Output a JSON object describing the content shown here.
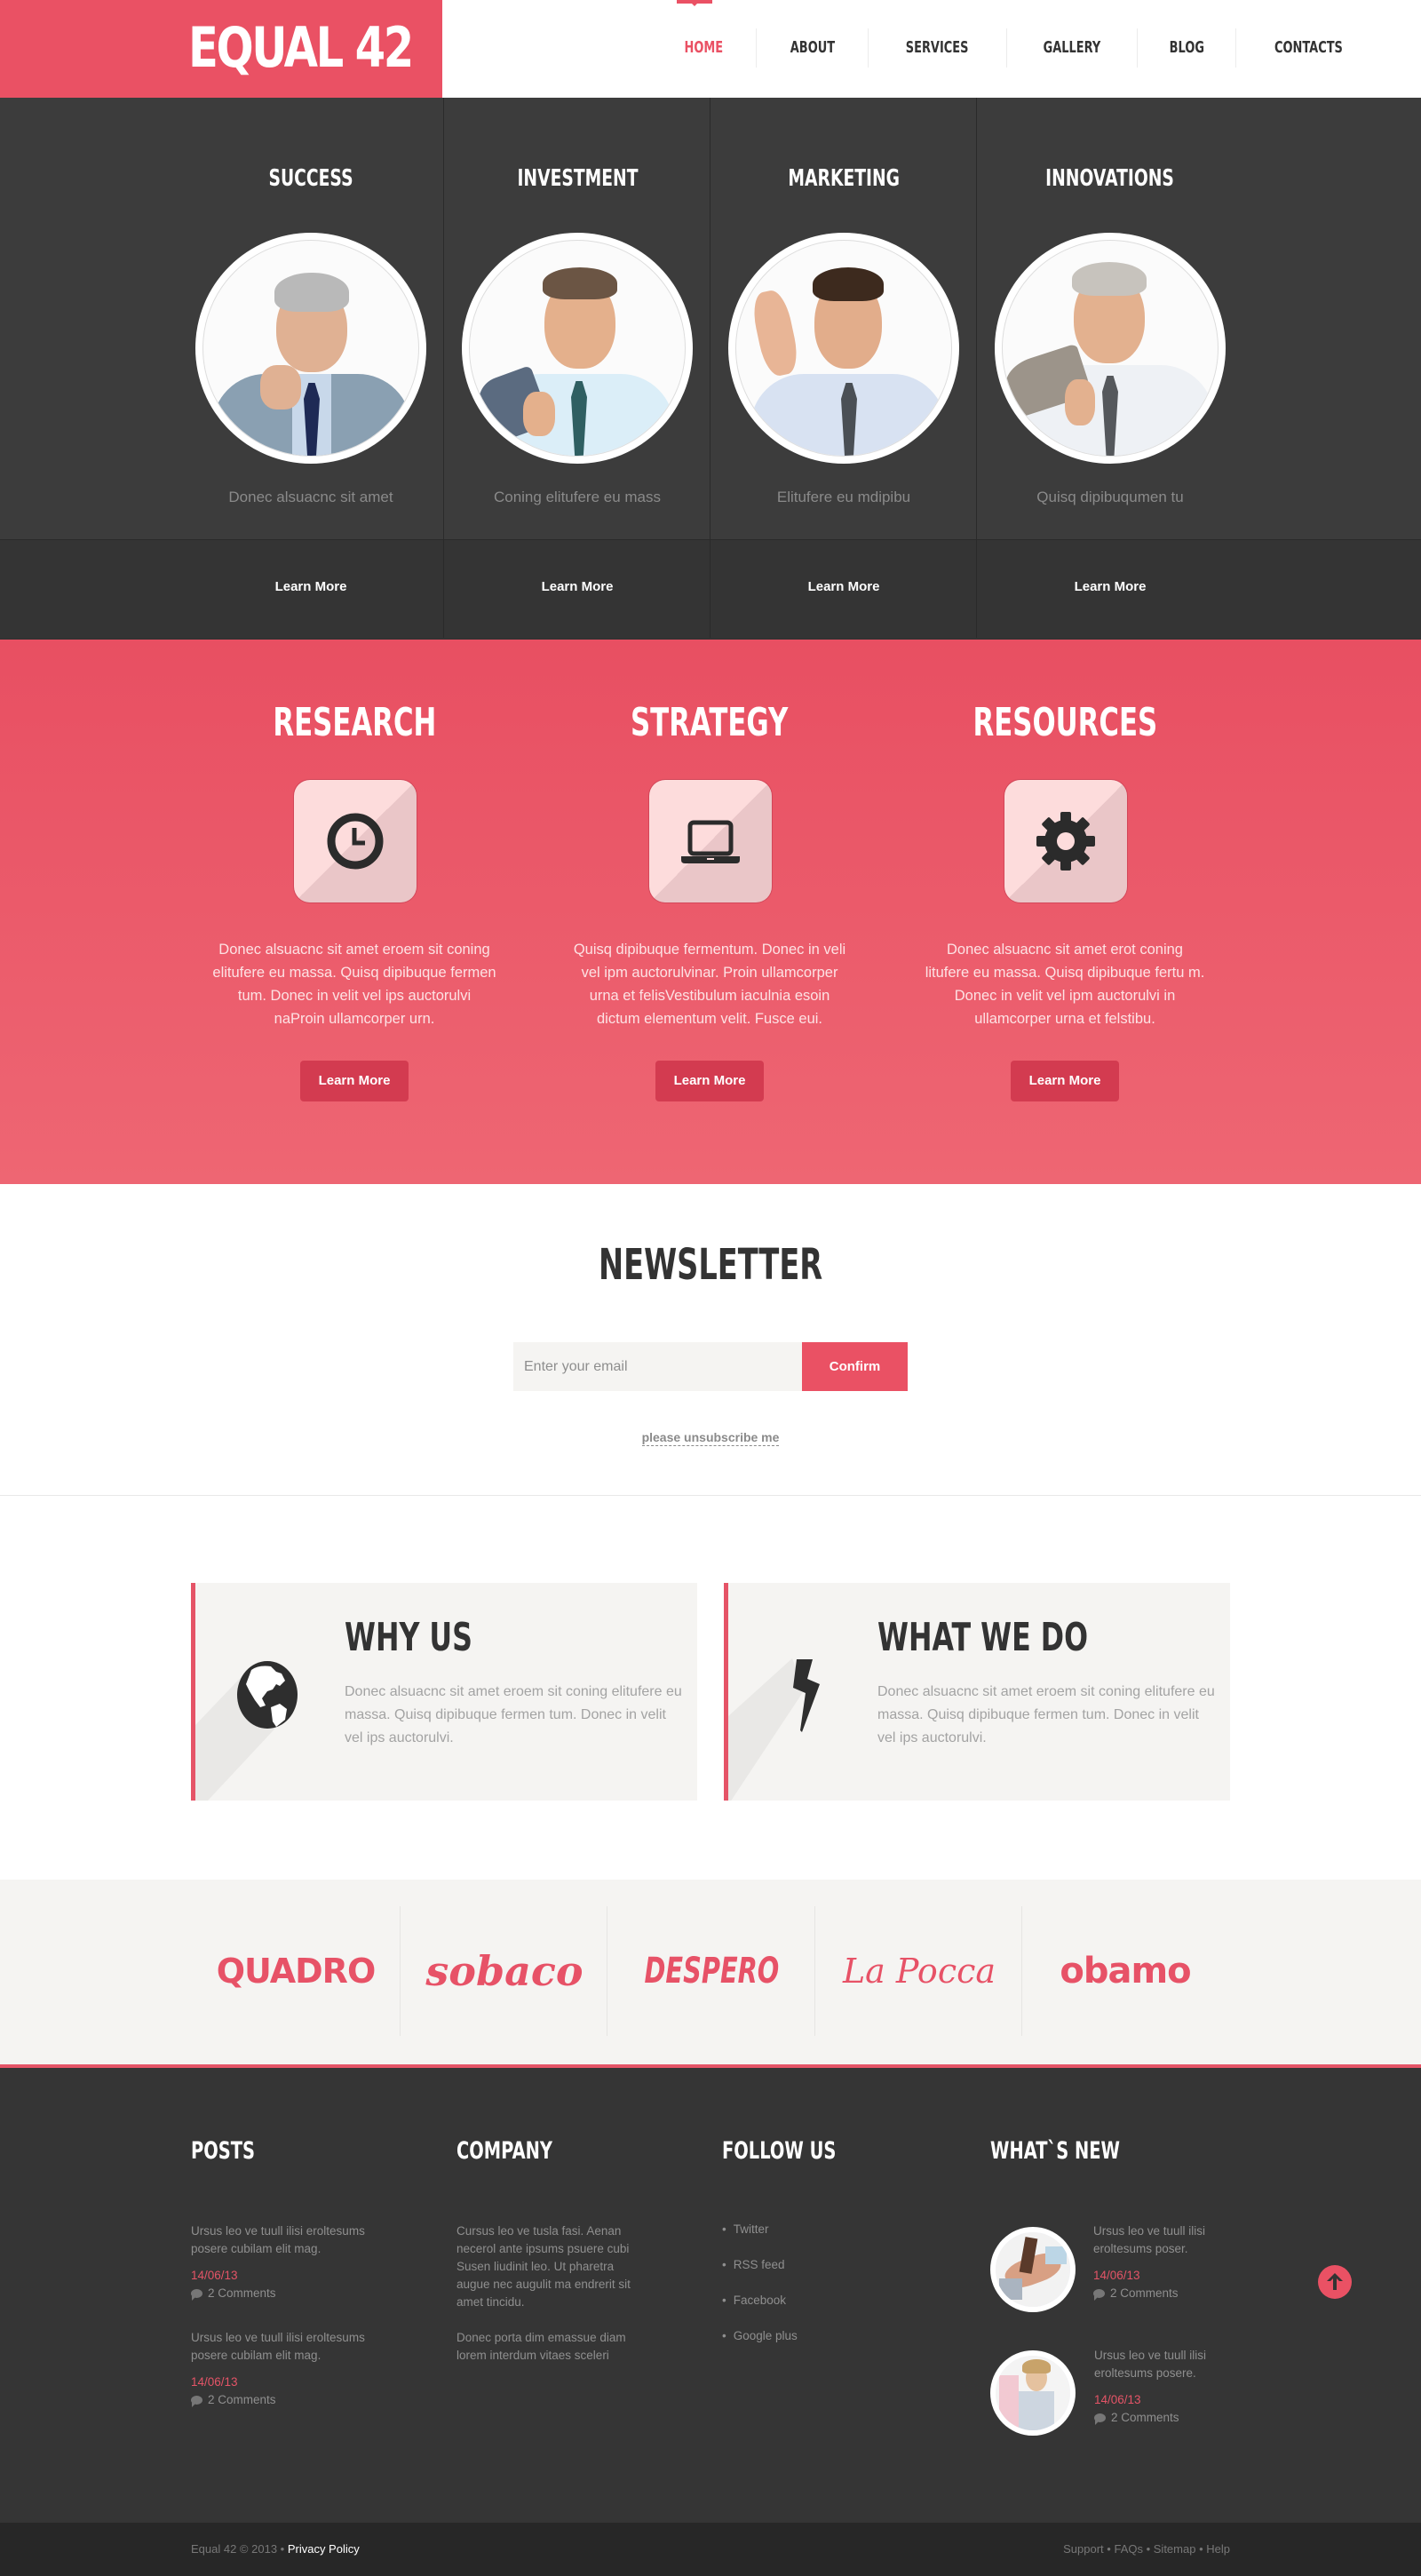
{
  "brand": {
    "name": "EQUAL 42",
    "accent": "#ea5164",
    "dark": "#353535"
  },
  "nav": {
    "items": [
      {
        "label": "HOME",
        "active": true
      },
      {
        "label": "ABOUT"
      },
      {
        "label": "SERVICES"
      },
      {
        "label": "GALLERY"
      },
      {
        "label": "BLOG"
      },
      {
        "label": "CONTACTS"
      }
    ]
  },
  "team": [
    {
      "title": "SUCCESS",
      "caption": "Donec alsuacnc sit amet",
      "link": "Learn More"
    },
    {
      "title": "INVESTMENT",
      "caption": "Coning elitufere eu mass",
      "link": "Learn More"
    },
    {
      "title": "MARKETING",
      "caption": "Elitufere eu mdipibu",
      "link": "Learn More"
    },
    {
      "title": "INNOVATIONS",
      "caption": "Quisq dipibuqumen tu",
      "link": "Learn More"
    }
  ],
  "features": [
    {
      "title": "RESEARCH",
      "icon": "clock-icon",
      "text": "Donec alsuacnc sit amet eroem sit coning elitufere eu massa. Quisq dipibuque fermen tum. Donec in velit vel ips auctorulvi naProin ullamcorper urn.",
      "button": "Learn More"
    },
    {
      "title": "STRATEGY",
      "icon": "laptop-icon",
      "text": "Quisq dipibuque fermentum. Donec in veli vel ipm auctorulvinar. Proin ullamcorper urna et felisVestibulum iaculnia esoin dictum elementum velit. Fusce eui.",
      "button": "Learn More"
    },
    {
      "title": "RESOURCES",
      "icon": "gear-icon",
      "text": "Donec alsuacnc sit amet erot coning litufere eu massa. Quisq dipibuque fertu m. Donec in velit vel ipm auctorulvi in ullamcorper urna et felstibu.",
      "button": "Learn More"
    }
  ],
  "newsletter": {
    "title": "NEWSLETTER",
    "placeholder": "Enter your email",
    "value": "",
    "confirm": "Confirm",
    "unsubscribe": "please unsubscribe me"
  },
  "cards": [
    {
      "title": "WHY US",
      "icon": "globe-icon",
      "text": "Donec alsuacnc sit amet eroem sit coning elitufere eu massa. Quisq dipibuque fermen tum. Donec in velit vel ips auctorulvi."
    },
    {
      "title": "WHAT WE DO",
      "icon": "lightning-icon",
      "text": "Donec alsuacnc sit amet eroem sit coning elitufere eu massa. Quisq dipibuque fermen tum. Donec in velit vel ips auctorulvi."
    }
  ],
  "partners": [
    "QUADRO",
    "sobaco",
    "DESPERO",
    "La Pocca",
    "obamo"
  ],
  "footer": {
    "posts": {
      "title": "POSTS",
      "items": [
        {
          "text": "Ursus leo ve tuull ilisi eroltesums posere cubilam elit mag.",
          "date": "14/06/13",
          "comments": "2 Comments"
        },
        {
          "text": "Ursus leo ve tuull ilisi eroltesums posere cubilam elit mag.",
          "date": "14/06/13",
          "comments": "2 Comments"
        }
      ]
    },
    "company": {
      "title": "COMPANY",
      "paragraphs": [
        "Cursus leo ve tusla fasi. Aenan necerol ante ipsums psuere cubi Susen liudinit leo. Ut pharetra augue nec augulit ma endrerit sit amet tincidu.",
        "Donec porta dim emassue diam lorem interdum vitaes sceleri"
      ]
    },
    "follow": {
      "title": "FOLLOW US",
      "links": [
        "Twitter",
        "RSS feed",
        "Facebook",
        "Google plus"
      ]
    },
    "whats_new": {
      "title": "WHAT`S NEW",
      "items": [
        {
          "text": "Ursus leo ve tuull ilisi eroltesums poser.",
          "date": "14/06/13",
          "comments": "2 Comments"
        },
        {
          "text": "Ursus leo ve tuull ilisi eroltesums posere.",
          "date": "14/06/13",
          "comments": "2 Comments"
        }
      ]
    }
  },
  "bottom": {
    "copyright": "Equal 42 © 2013 • ",
    "privacy": "Privacy Policy",
    "links": [
      "Support",
      "FAQs",
      "Sitemap",
      "Help"
    ],
    "separator": " • "
  }
}
